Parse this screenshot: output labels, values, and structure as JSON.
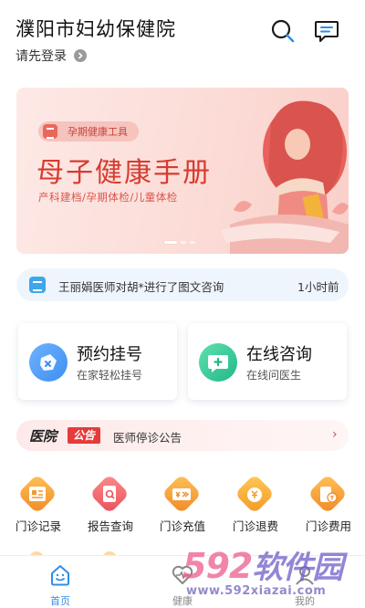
{
  "header": {
    "hospital_name": "濮阳市妇幼保健院",
    "login_text": "请先登录",
    "icons": {
      "search": "search-icon",
      "message": "message-icon",
      "arrow": "chevron-right-icon"
    }
  },
  "banner": {
    "tag": "孕期健康工具",
    "title": "母子健康手册",
    "subtitle": "产科建档/孕期体检/儿童体检",
    "colors": {
      "title": "#d73b2f",
      "background": "#fcdcd7"
    },
    "active_slide": 1,
    "slide_count": 3
  },
  "notice": {
    "text": "王丽娟医师对胡*进行了图文咨询",
    "time": "1小时前",
    "icon": "chat-icon"
  },
  "cards": [
    {
      "title": "预约挂号",
      "subtitle": "在家轻松挂号",
      "icon": "ticket-icon",
      "color": "#3d8ff0"
    },
    {
      "title": "在线咨询",
      "subtitle": "在线问医生",
      "icon": "chat-plus-icon",
      "color": "#2ec48f"
    }
  ],
  "announcement": {
    "prefix": "医院",
    "badge": "公告",
    "text": "医师停诊公告",
    "arrow": "›"
  },
  "services": [
    {
      "label": "门诊记录",
      "icon": "record-icon",
      "color": "#f7a23a"
    },
    {
      "label": "报告查询",
      "icon": "report-search-icon",
      "color": "#f0646a"
    },
    {
      "label": "门诊充值",
      "icon": "recharge-icon",
      "color": "#f6a53c"
    },
    {
      "label": "门诊退费",
      "icon": "refund-icon",
      "color": "#f5b13a"
    },
    {
      "label": "门诊费用",
      "icon": "fee-icon",
      "color": "#f7a23a"
    }
  ],
  "bottom_nav": [
    {
      "label": "首页",
      "icon": "home-smile-icon",
      "active": true
    },
    {
      "label": "健康",
      "icon": "heart-icon",
      "active": false
    },
    {
      "label": "我的",
      "icon": "user-icon",
      "active": false
    }
  ],
  "watermark": {
    "logo_num": "592",
    "logo_text": "软件园",
    "url": "www.592xiazai.com"
  }
}
